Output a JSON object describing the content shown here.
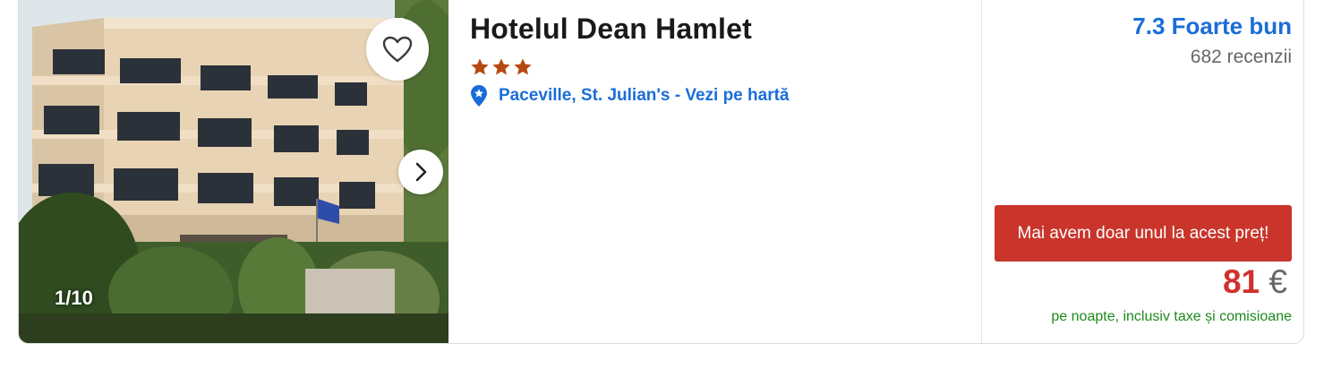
{
  "hotel": {
    "name": "Hotelul Dean Hamlet",
    "star_count": 3,
    "star_color": "#b5490f",
    "location": "Paceville, St. Julian's - Vezi pe hartă"
  },
  "gallery": {
    "counter": "1/10",
    "favorite_icon": "heart-outline-icon",
    "next_icon": "chevron-right-icon"
  },
  "review": {
    "score_label": "7.3 Foarte bun",
    "count_label": "682 recenzii"
  },
  "offer": {
    "banner": "Mai avem doar unul la acest preț!",
    "amount": "81",
    "currency": "€",
    "note": "pe noapte, inclusiv taxe și comisioane"
  },
  "colors": {
    "link_blue": "#1a6dd8",
    "banner_red": "#c9352b",
    "price_red": "#d0312d",
    "note_green": "#1c8a1c"
  }
}
